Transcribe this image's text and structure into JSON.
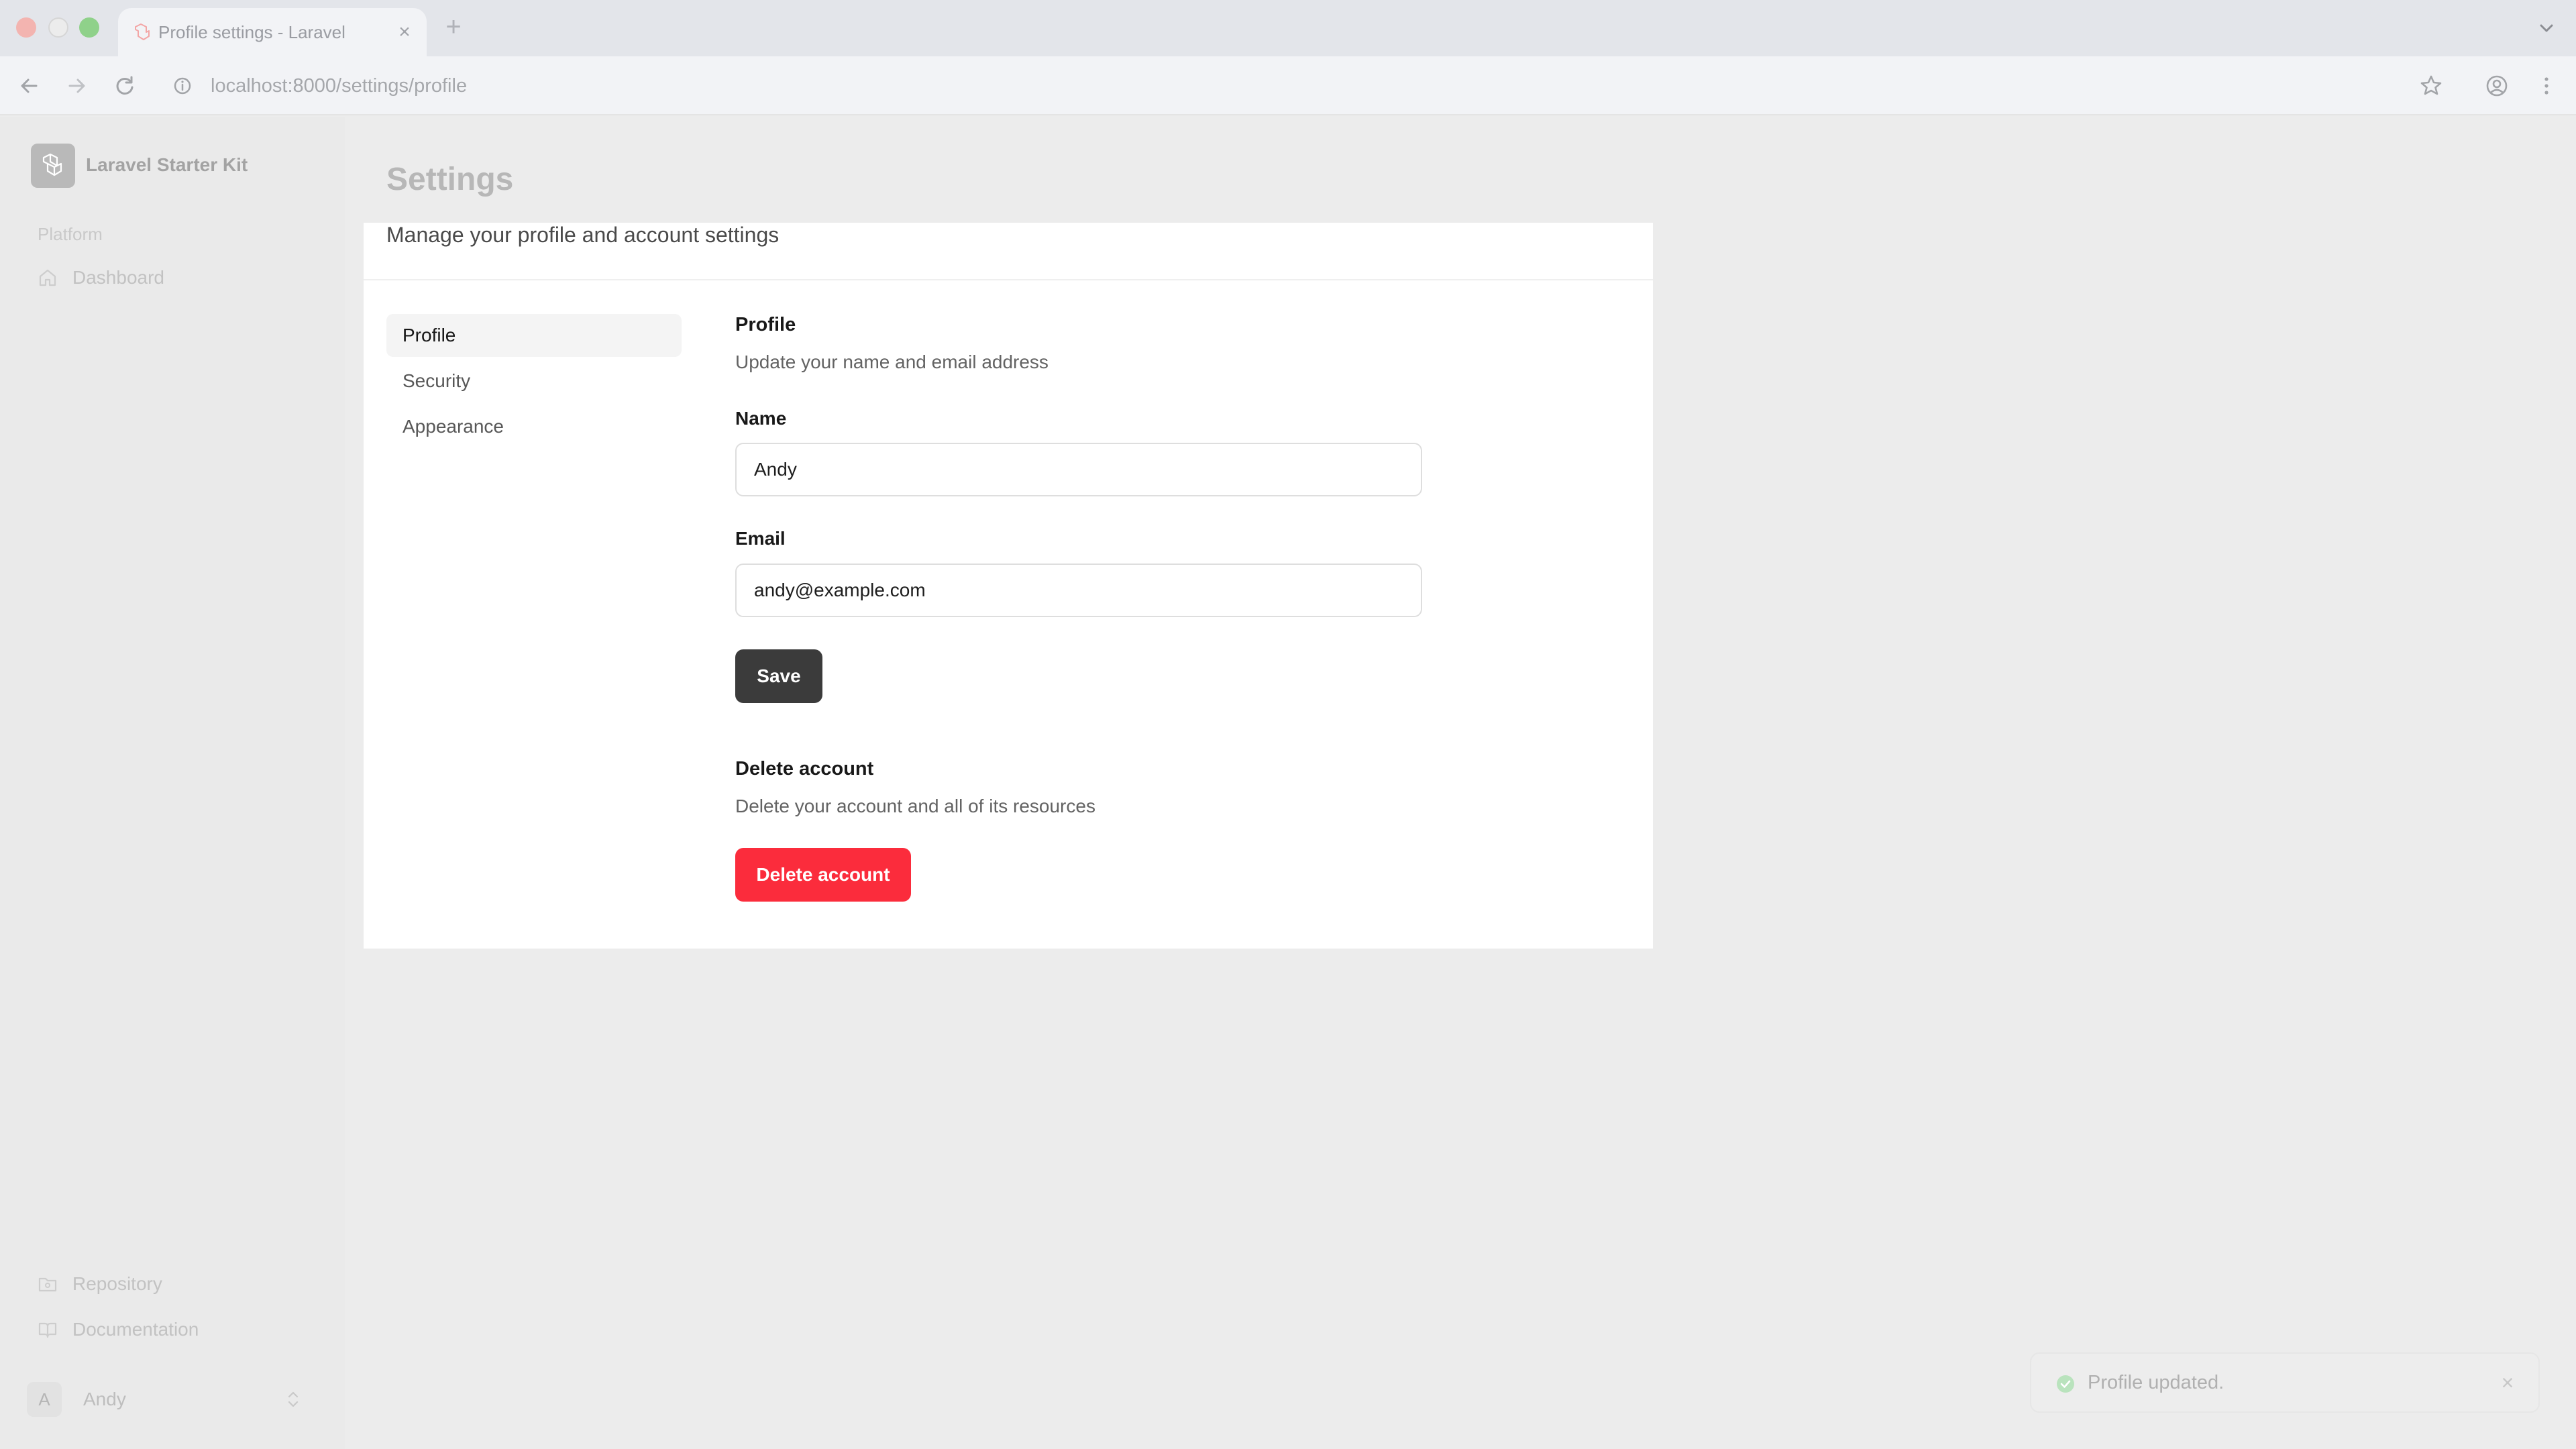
{
  "browser": {
    "tab_title": "Profile settings - Laravel",
    "tab_close": "×",
    "new_tab": "+",
    "url": "localhost:8000/settings/profile"
  },
  "sidebar": {
    "app_name": "Laravel Starter Kit",
    "group_label": "Platform",
    "nav": [
      {
        "label": "Dashboard",
        "icon": "home-icon"
      }
    ],
    "footer_links": [
      {
        "label": "Repository",
        "icon": "folder-git-icon"
      },
      {
        "label": "Documentation",
        "icon": "book-open-icon"
      }
    ],
    "user": {
      "initial": "A",
      "name": "Andy"
    }
  },
  "page": {
    "title": "Settings",
    "subtitle": "Manage your profile and account settings"
  },
  "settings_nav": [
    {
      "label": "Profile",
      "active": true
    },
    {
      "label": "Security",
      "active": false
    },
    {
      "label": "Appearance",
      "active": false
    }
  ],
  "profile": {
    "title": "Profile",
    "description": "Update your name and email address",
    "name_label": "Name",
    "name_value": "Andy",
    "email_label": "Email",
    "email_value": "andy@example.com",
    "save_label": "Save"
  },
  "delete_account": {
    "title": "Delete account",
    "description": "Delete your account and all of its resources",
    "button_label": "Delete account"
  },
  "toast": {
    "message": "Profile updated.",
    "close": "×"
  },
  "colors": {
    "primary_button": "#3b3b3b",
    "danger_button": "#fb2c3c",
    "page_background": "#ececec",
    "card_background": "#ffffff"
  }
}
